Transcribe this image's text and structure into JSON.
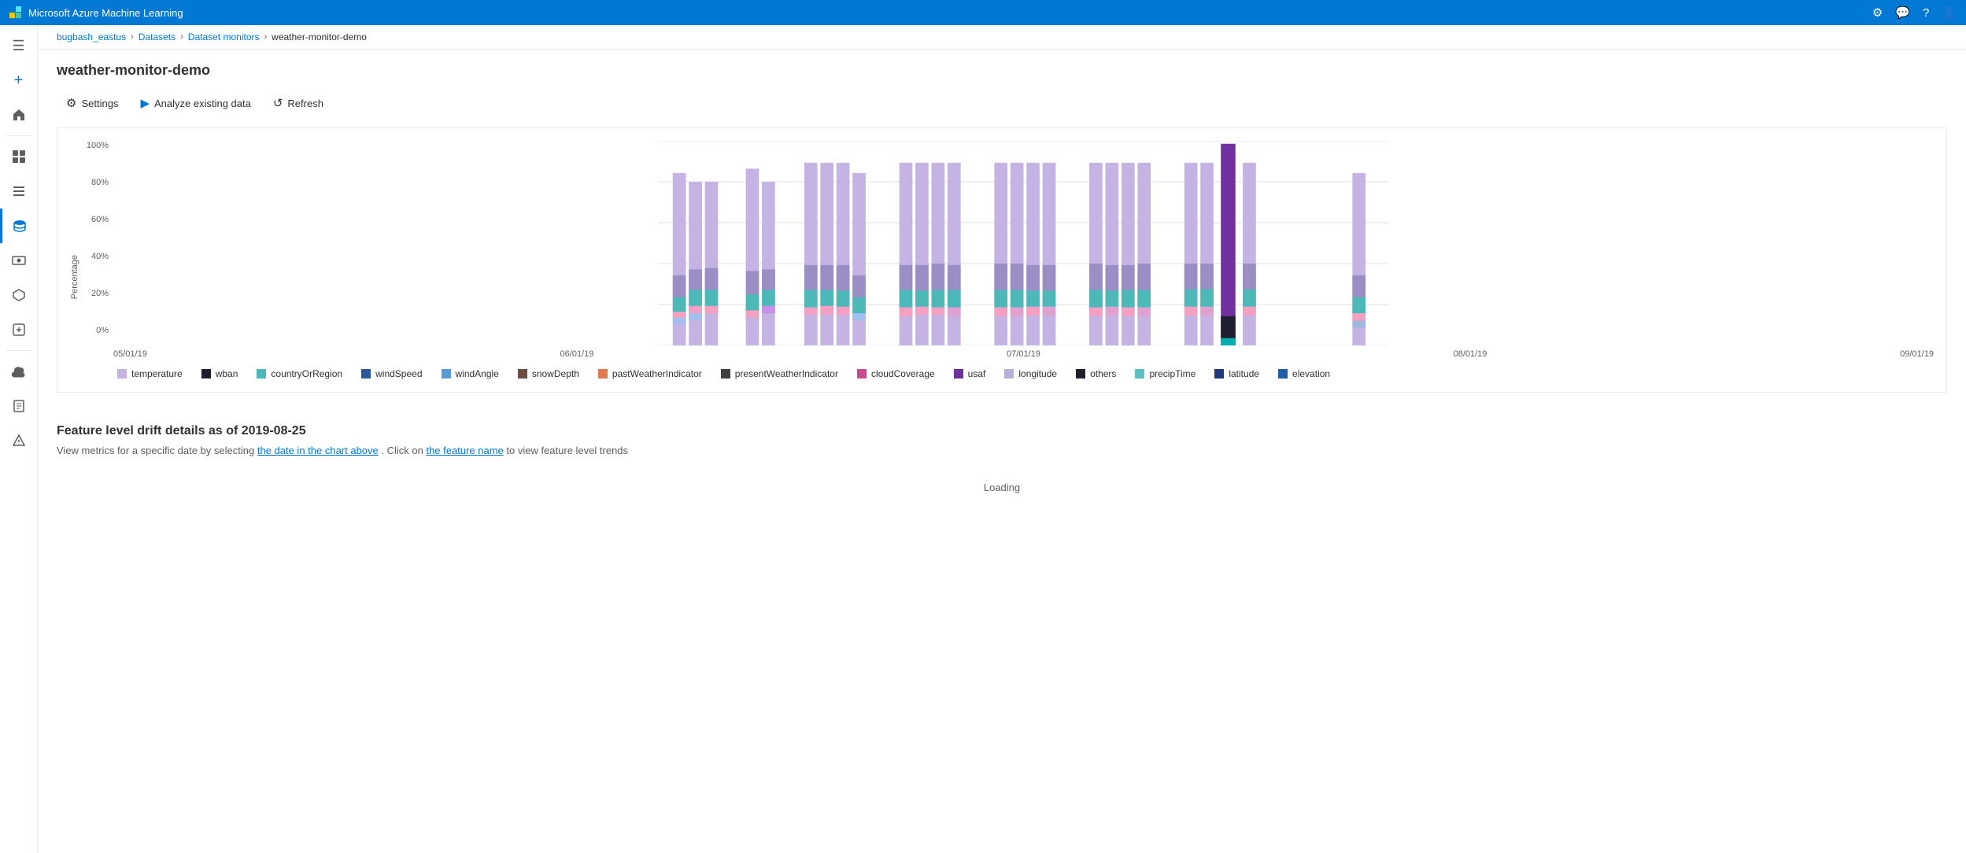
{
  "app": {
    "title": "Microsoft Azure Machine Learning"
  },
  "topbar": {
    "title": "Microsoft Azure Machine Learning",
    "icons": [
      "settings",
      "feedback",
      "help",
      "account"
    ]
  },
  "breadcrumb": {
    "items": [
      {
        "label": "bugbash_eastus",
        "link": true
      },
      {
        "label": "Datasets",
        "link": true
      },
      {
        "label": "Dataset monitors",
        "link": true
      },
      {
        "label": "weather-monitor-demo",
        "link": false
      }
    ]
  },
  "page": {
    "title": "weather-monitor-demo"
  },
  "toolbar": {
    "buttons": [
      {
        "id": "settings",
        "label": "Settings",
        "icon": "⚙"
      },
      {
        "id": "analyze",
        "label": "Analyze existing data",
        "icon": "▶"
      },
      {
        "id": "refresh",
        "label": "Refresh",
        "icon": "↺"
      }
    ]
  },
  "chart": {
    "y_axis": {
      "title": "Percentage",
      "labels": [
        "100%",
        "80%",
        "60%",
        "40%",
        "20%",
        "0%"
      ]
    },
    "x_labels": [
      "05/01/19",
      "06/01/19",
      "07/01/19",
      "08/01/19",
      "09/01/19"
    ],
    "legend": [
      {
        "label": "temperature",
        "color": "#c5b4e3"
      },
      {
        "label": "wban",
        "color": "#1e1e2e"
      },
      {
        "label": "countryOrRegion",
        "color": "#4db8b8"
      },
      {
        "label": "windSpeed",
        "color": "#2b579a"
      },
      {
        "label": "windAngle",
        "color": "#5b9bd5"
      },
      {
        "label": "snowDepth",
        "color": "#6d4c41"
      },
      {
        "label": "pastWeatherIndicator",
        "color": "#e07b4f"
      },
      {
        "label": "presentWeatherIndicator",
        "color": "#404040"
      },
      {
        "label": "cloudCoverage",
        "color": "#c84b8e"
      },
      {
        "label": "usaf",
        "color": "#7030a0"
      },
      {
        "label": "longitude",
        "color": "#b8b0d8"
      },
      {
        "label": "others",
        "color": "#1e1e2e"
      },
      {
        "label": "precipTime",
        "color": "#5ebfbf"
      },
      {
        "label": "latitude",
        "color": "#1e3a7a"
      },
      {
        "label": "elevation",
        "color": "#1e5fa8"
      }
    ]
  },
  "drift_section": {
    "title": "Feature level drift details as of 2019-08-25",
    "subtitle_parts": [
      "View metrics for a specific date by selecting ",
      "the date in the chart above",
      ". Click on ",
      "the feature name",
      " to view feature level trends"
    ],
    "loading": "Loading"
  },
  "sidebar": {
    "items": [
      {
        "id": "menu",
        "icon": "☰"
      },
      {
        "id": "new",
        "icon": "+"
      },
      {
        "id": "home",
        "icon": "⌂"
      },
      {
        "id": "workspace",
        "icon": "◫"
      },
      {
        "id": "pipelines",
        "icon": "≡"
      },
      {
        "id": "datasets",
        "icon": "⬚",
        "active": true
      },
      {
        "id": "compute",
        "icon": "◻"
      },
      {
        "id": "models",
        "icon": "▪"
      },
      {
        "id": "deploy",
        "icon": "📦"
      },
      {
        "id": "cloud",
        "icon": "☁"
      },
      {
        "id": "monitor",
        "icon": "📊"
      },
      {
        "id": "notes",
        "icon": "📝"
      }
    ]
  }
}
